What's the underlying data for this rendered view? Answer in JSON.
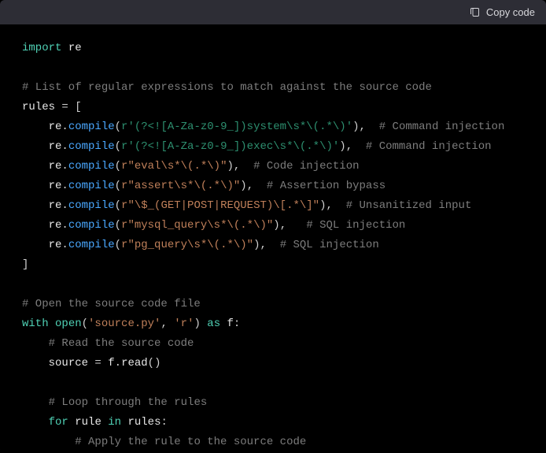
{
  "header": {
    "copy_label": "Copy code"
  },
  "code": {
    "kw_import": "import",
    "mod_re": "re",
    "c_rules_desc": "# List of regular expressions to match against the source code",
    "var_rules": "rules",
    "eq": " = ",
    "lbracket": "[",
    "indent4": "    ",
    "indent8": "        ",
    "re_prefix": "re",
    "dot": ".",
    "fn_compile": "compile",
    "lparen": "(",
    "rparen": ")",
    "comma": ",",
    "space2": "  ",
    "space3": "   ",
    "pat1": "r'(?<![A-Za-z0-9_])system\\s*\\(.*\\)'",
    "c1": "# Command injection",
    "pat2": "r'(?<![A-Za-z0-9_])exec\\s*\\(.*\\)'",
    "c2": "# Command injection",
    "pat3": "r\"eval\\s*\\(.*\\)\"",
    "c3": "# Code injection",
    "pat4": "r\"assert\\s*\\(.*\\)\"",
    "c4": "# Assertion bypass",
    "pat5": "r\"\\$_(GET|POST|REQUEST)\\[.*\\]\"",
    "c5": "# Unsanitized input",
    "pat6": "r\"mysql_query\\s*\\(.*\\)\"",
    "c6": "# SQL injection",
    "pat7": "r\"pg_query\\s*\\(.*\\)\"",
    "c7": "# SQL injection",
    "rbracket": "]",
    "c_open": "# Open the source code file",
    "kw_with": "with",
    "sp": " ",
    "fn_open": "open",
    "str_source": "'source.py'",
    "str_r": "'r'",
    "kw_as": "as",
    "var_f": "f",
    "colon": ":",
    "c_read": "# Read the source code",
    "var_source": "source",
    "fn_read": "read",
    "empty_parens": "()",
    "c_loop": "# Loop through the rules",
    "kw_for": "for",
    "var_rule": "rule",
    "kw_in": "in",
    "c_apply": "# Apply the rule to the source code"
  }
}
